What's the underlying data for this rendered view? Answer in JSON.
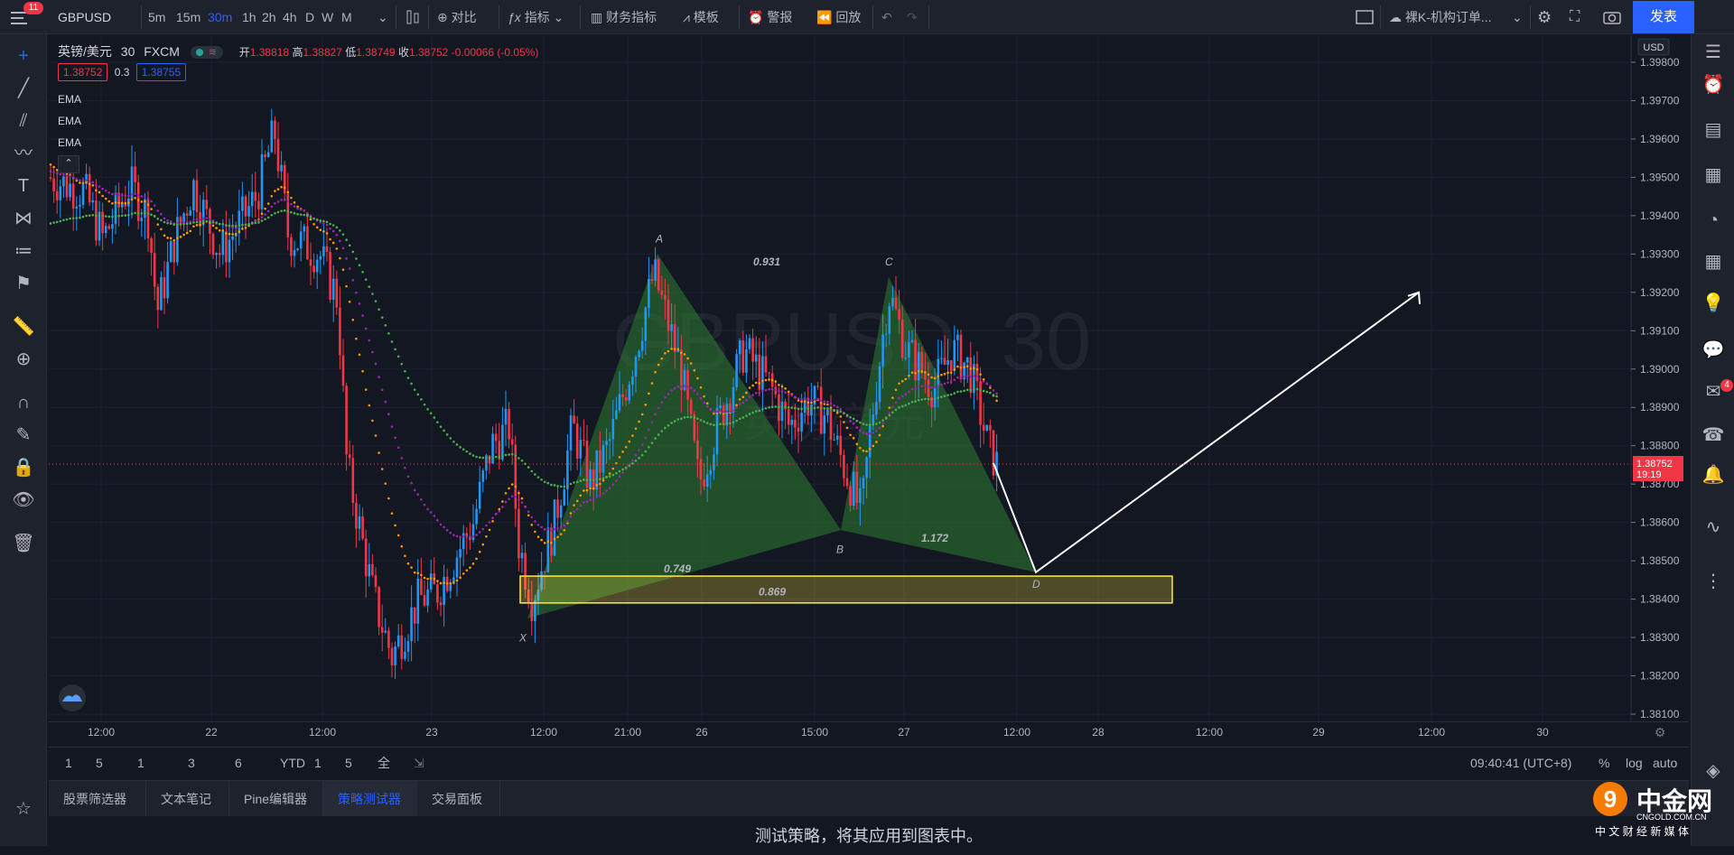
{
  "toolbar": {
    "notifications": "11",
    "symbol": "GBPUSD",
    "intervals": [
      "5m",
      "15m",
      "30m",
      "1h",
      "2h",
      "4h",
      "D",
      "W",
      "M"
    ],
    "active_interval": "30m",
    "compare": "对比",
    "indicators": "指标",
    "financials": "财务指标",
    "templates": "模板",
    "alerts": "警报",
    "replay": "回放",
    "layout_name": "裸K-机构订单...",
    "publish": "发表"
  },
  "legend": {
    "title": "英镑/美元",
    "interval": "30",
    "exchange": "FXCM",
    "open_label": "开",
    "open": "1.38818",
    "high_label": "高",
    "high": "1.38827",
    "low_label": "低",
    "low": "1.38749",
    "close_label": "收",
    "close": "1.38752",
    "change": "-0.00066 (-0.05%)",
    "bid": "1.38752",
    "spread": "0.3",
    "ask": "1.38755",
    "indicators": [
      "EMA",
      "EMA",
      "EMA"
    ]
  },
  "watermark": {
    "symbol": "GBPUSD, 30",
    "name": "英镑/美元"
  },
  "currency": "USD",
  "price_axis": [
    "1.39800",
    "1.39700",
    "1.39600",
    "1.39500",
    "1.39400",
    "1.39300",
    "1.39200",
    "1.39100",
    "1.39000",
    "1.38900",
    "1.38800",
    "1.38700",
    "1.38600",
    "1.38500",
    "1.38400",
    "1.38300",
    "1.38200",
    "1.38100"
  ],
  "current_price": {
    "value": "1.38752",
    "countdown": "19:19"
  },
  "time_axis": [
    "12:00",
    "22",
    "12:00",
    "23",
    "12:00",
    "21:00",
    "26",
    "15:00",
    "27",
    "12:00",
    "28",
    "12:00",
    "29",
    "12:00",
    "30"
  ],
  "pattern": {
    "points": [
      "X",
      "A",
      "B",
      "C",
      "D"
    ],
    "ratios": [
      "0.931",
      "0.749",
      "1.172",
      "0.869"
    ]
  },
  "colors": {
    "up": "#2196f3",
    "down": "#f23645",
    "ema_fast": "#ff9800",
    "ema_mid": "#9c27b0",
    "ema_slow": "#4caf50",
    "pattern_fill": "#2e7d32",
    "zone": "#ffeb3b"
  },
  "bottom": {
    "ranges": [
      "1天",
      "5天",
      "1个月",
      "3个月",
      "6个月",
      "YTD",
      "1年",
      "5年",
      "全部"
    ],
    "clock": "09:40:41 (UTC+8)",
    "percent": "%",
    "log": "log",
    "auto": "auto"
  },
  "tabs": [
    "股票筛选器",
    "文本笔记",
    "Pine编辑器",
    "策略测试器",
    "交易面板"
  ],
  "active_tab": "策略测试器",
  "panel_message": "测试策略，将其应用到图表中。",
  "right_badge": "4",
  "watermark_logo": {
    "name": "中金网",
    "url": "CNGOLD.COM.CN",
    "tagline": "中 文 财 经 新 媒 体"
  }
}
